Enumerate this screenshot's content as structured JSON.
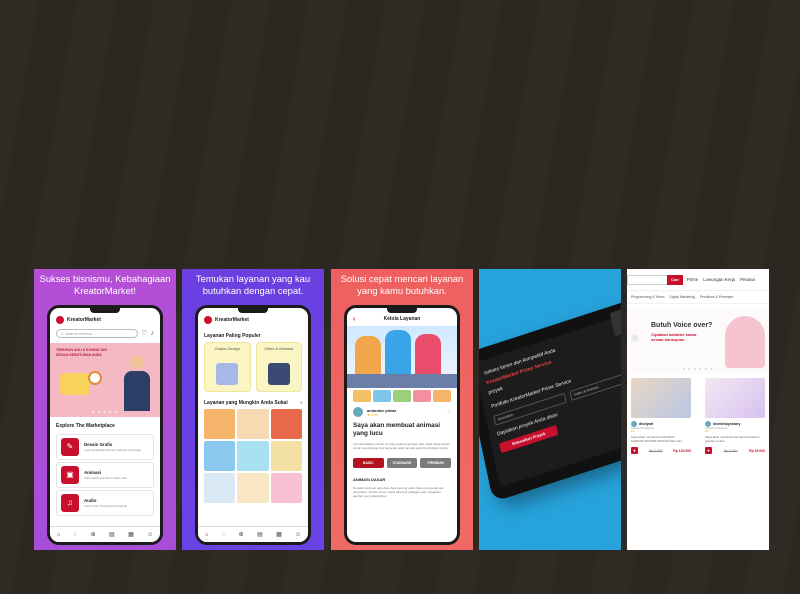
{
  "panels": [
    {
      "caption": "Sukses bisnismu, Kebahagiaan KreatorMarket!",
      "app_name": "KreatorMarket",
      "search_placeholder": "Search Service...",
      "hero_text": "TEMUKAN AHLI & KONSULTAN SESUAI KEBUTUHAN ANDA",
      "section_title": "Explore The Marketplace",
      "categories": [
        {
          "title": "Desain Grafis",
          "sub": "Logo & Identitas Merek, Ilustrasi, Kemasan",
          "icon": "palette-icon",
          "glyph": "✎"
        },
        {
          "title": "Animasi",
          "sub": "Video Editing & Short Video Ads",
          "icon": "camera-icon",
          "glyph": "▣"
        },
        {
          "title": "Audio",
          "sub": "Voice Over, Pembuatan & Musik",
          "icon": "headphones-icon",
          "glyph": "♫"
        }
      ]
    },
    {
      "caption": "Temukan layanan yang kau butuhkan dengan cepat.",
      "app_name": "KreatorMarket",
      "popular_title": "Layanan Paling Populer",
      "popular": [
        "Grapic Design",
        "Video & Animasi"
      ],
      "grid_title": "Layanan yang Mungkin Anda Sukai"
    },
    {
      "caption": "Solusi cepat mencari layanan yang kamu butuhkan.",
      "header": "Kelola Layanan",
      "seller": "animotor pintar",
      "rating": "★ 4.90",
      "title": "Saya akan membuat animasi yang lucu",
      "desc": "Animasi adalah metode di mana sebuah gambar atau objek dimanipulasi untuk menciptakan ilusi bergerak yang tampak seperti kehidupan nyata.",
      "tiers": [
        "BASIC",
        "STANDARD",
        "PREMIUM"
      ],
      "sub": "ANIMASI DASAR",
      "sub_desc": "Di dalam animasi satu dua objek penting yaitu objek yang gerak dan yang diam. Secara umum objek dibentuk sebagai suatu rangkaian gambar yang ditampilkan"
    },
    {
      "line1": "sukses keren dan kompetitif Anda",
      "line2": "KreatorMarket Prime Service.",
      "line3": "proyek",
      "label": "Portfolio KreatorMarket Prime Service",
      "inputs": [
        "Animation",
        "Video & Animasi"
      ],
      "line4": "Dapatkan proyek Anda disini",
      "button": "Selesaikan Proyek",
      "logo": "Pri"
    },
    {
      "search_button": "Cari",
      "links": [
        "Prime",
        "Lowongan Kerja",
        "Pesana"
      ],
      "cats": [
        "Programming & Tekno",
        "Digital Marketing",
        "Penulisan & Penerjem"
      ],
      "banner_title": "Butuh Voice over?",
      "banner_sub": "Ciptakan karakter suara sesuai konsepmu",
      "cards": [
        {
          "seller": "dhotyart",
          "level": "Kategori Freelancer",
          "rating": "4.9",
          "desc": "Saya akan membuat ILUSTRASI KARIKATUR/KARTUNISASI Dari Foto",
          "old": "Rp 2.500",
          "price": "Rp 125.000"
        },
        {
          "seller": "lovedesignstory",
          "level": "Kategori Freelancer",
          "rating": "5.0",
          "desc": "Saya akan membuat animasi dan konten graphic motion",
          "old": "Rp 5.000",
          "price": "Rp 25.000"
        }
      ]
    }
  ]
}
